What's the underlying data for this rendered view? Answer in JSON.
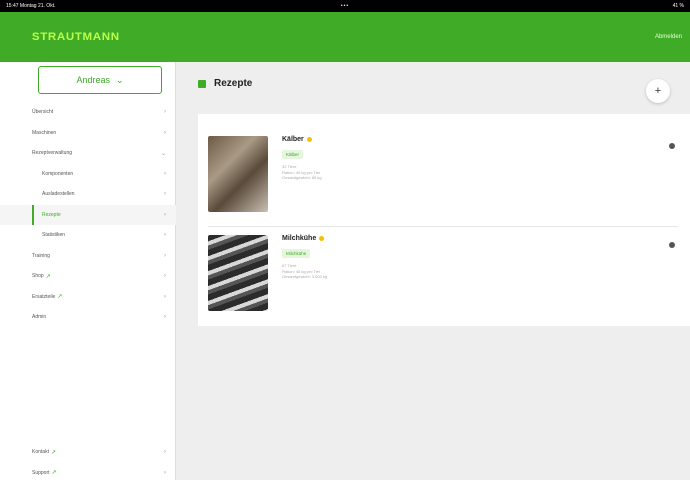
{
  "statusbar": {
    "left": "15:47  Montag 21. Okt.",
    "center": "•••",
    "right": "41 %"
  },
  "header": {
    "logo": "STRAUTMANN",
    "action": "Abmelden"
  },
  "sidebar": {
    "user": "Andreas",
    "items": [
      {
        "label": "Übersicht",
        "sub": false,
        "active": false,
        "external": false
      },
      {
        "label": "Maschinen",
        "sub": false,
        "active": false,
        "external": false
      },
      {
        "label": "Rezeptverwaltung",
        "sub": false,
        "active": false,
        "external": false
      },
      {
        "label": "Komponenten",
        "sub": true,
        "active": false,
        "external": false
      },
      {
        "label": "Ausladestellen",
        "sub": true,
        "active": false,
        "external": false
      },
      {
        "label": "Rezepte",
        "sub": true,
        "active": true,
        "external": false
      },
      {
        "label": "Statistiken",
        "sub": true,
        "active": false,
        "external": false
      },
      {
        "label": "Training",
        "sub": false,
        "active": false,
        "external": false
      },
      {
        "label": "Shop",
        "sub": false,
        "active": false,
        "external": true
      },
      {
        "label": "Ersatzteile",
        "sub": false,
        "active": false,
        "external": true
      },
      {
        "label": "Admin",
        "sub": false,
        "active": false,
        "external": false
      }
    ],
    "bottom_items": [
      {
        "label": "Kontakt",
        "external": true
      },
      {
        "label": "Support",
        "external": true
      }
    ]
  },
  "main": {
    "title": "Rezepte",
    "add_label": "+",
    "recipes": [
      {
        "name": "Kälber",
        "badge": "Kälber",
        "lines": [
          "32 Tiere",
          "Ration: 40 kg pro Tier",
          "Gesamtgewicht: 80 kg"
        ]
      },
      {
        "name": "Milchkühe",
        "badge": "Milchkühe",
        "lines": [
          "67 Tiere",
          "Ration: 45 kg pro Tier",
          "Gesamtgewicht: 3.000 kg"
        ]
      }
    ]
  },
  "colors": {
    "brand": "#3fab27",
    "logo": "#b9ff4a",
    "favorite": "#f2c200"
  }
}
